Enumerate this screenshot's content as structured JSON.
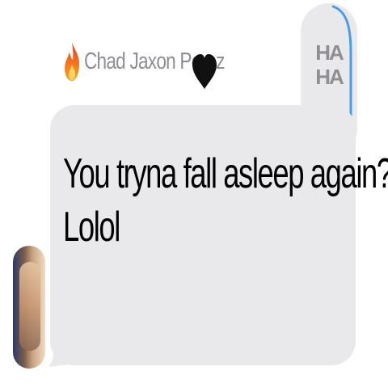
{
  "message": {
    "sender_name": "Chad Jaxon Perez",
    "sender_prefix_icon": "fire-icon",
    "sender_suffix_icon": "black-heart-icon",
    "lines": [
      "You tryna fall asleep again?",
      "Lolol"
    ]
  },
  "reaction": {
    "line1": "HA",
    "line2": "HA"
  },
  "colors": {
    "bubble": "#e9e9eb",
    "sender_name": "#8e8e93",
    "reaction_edge": "#4a9be8",
    "text": "#000000"
  }
}
